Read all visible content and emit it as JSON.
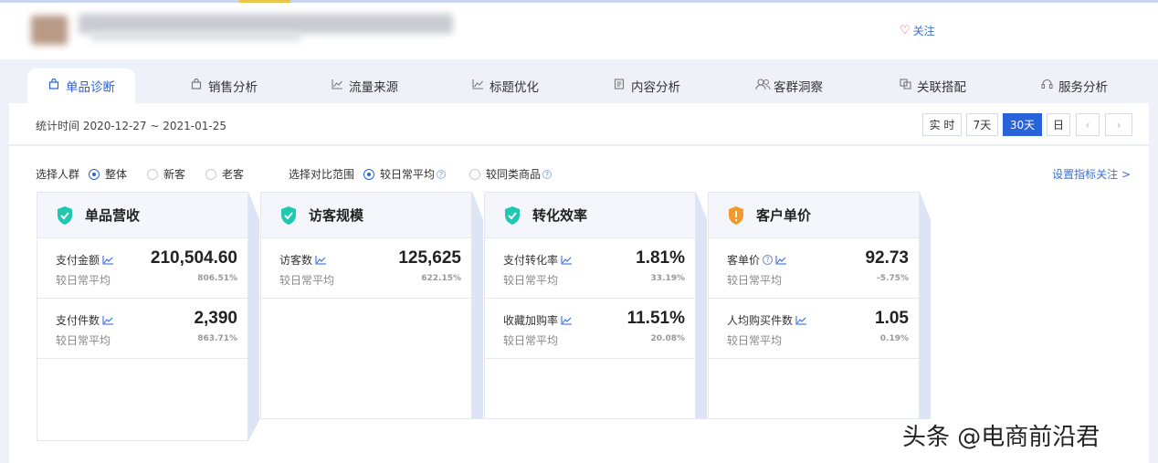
{
  "header": {
    "follow_label": "关注"
  },
  "tabs": [
    {
      "label": "单品诊断",
      "icon": "bag-icon"
    },
    {
      "label": "销售分析",
      "icon": "bag-icon"
    },
    {
      "label": "流量来源",
      "icon": "line-chart-icon"
    },
    {
      "label": "标题优化",
      "icon": "line-chart-icon"
    },
    {
      "label": "内容分析",
      "icon": "document-icon"
    },
    {
      "label": "客群洞察",
      "icon": "users-icon"
    },
    {
      "label": "关联搭配",
      "icon": "link-icon"
    },
    {
      "label": "服务分析",
      "icon": "headset-icon"
    }
  ],
  "date": {
    "range": "统计时间 2020-12-27 ~ 2021-01-25",
    "buttons": [
      "实 时",
      "7天",
      "30天",
      "日"
    ],
    "active": "30天"
  },
  "filters": {
    "crowd_label": "选择人群",
    "crowd_options": [
      "整体",
      "新客",
      "老客"
    ],
    "compare_label": "选择对比范围",
    "compare_options": [
      "较日常平均",
      "较同类商品"
    ],
    "settings_link": "设置指标关注 >"
  },
  "cards": [
    {
      "title": "单品营收",
      "status": "ok",
      "rows": [
        {
          "label": "支付金额",
          "value": "210,504.60",
          "sub": "较日常平均",
          "pct": "806.51%"
        },
        {
          "label": "支付件数",
          "value": "2,390",
          "sub": "较日常平均",
          "pct": "863.71%"
        }
      ]
    },
    {
      "title": "访客规模",
      "status": "ok",
      "rows": [
        {
          "label": "访客数",
          "value": "125,625",
          "sub": "较日常平均",
          "pct": "622.15%"
        }
      ]
    },
    {
      "title": "转化效率",
      "status": "ok",
      "rows": [
        {
          "label": "支付转化率",
          "value": "1.81%",
          "sub": "较日常平均",
          "pct": "33.19%"
        },
        {
          "label": "收藏加购率",
          "value": "11.51%",
          "sub": "较日常平均",
          "pct": "20.08%"
        }
      ]
    },
    {
      "title": "客户单价",
      "status": "warn",
      "rows": [
        {
          "label": "客单价",
          "value": "92.73",
          "sub": "较日常平均",
          "pct": "-5.75%"
        },
        {
          "label": "人均购买件数",
          "value": "1.05",
          "sub": "较日常平均",
          "pct": "0.19%"
        }
      ]
    }
  ],
  "watermark": "头条 @电商前沿君",
  "colors": {
    "accent": "#2962d9",
    "ok": "#1fc9b0",
    "warn": "#f29a2e"
  }
}
